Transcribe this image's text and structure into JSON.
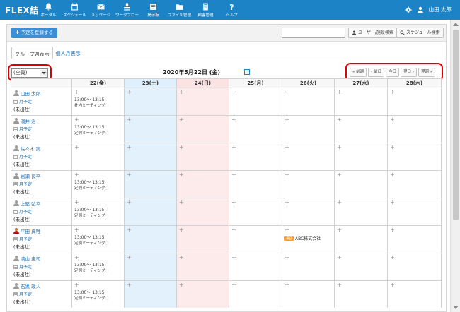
{
  "app": {
    "logo": "FLEX結"
  },
  "nav": [
    {
      "label": "ポータル",
      "icon": "bell-icon"
    },
    {
      "label": "スケジュール",
      "icon": "calendar-icon"
    },
    {
      "label": "メッセージ",
      "icon": "mail-icon"
    },
    {
      "label": "ワークフロー",
      "icon": "stamp-icon"
    },
    {
      "label": "掲示板",
      "icon": "board-icon"
    },
    {
      "label": "ファイル管理",
      "icon": "folder-icon"
    },
    {
      "label": "顧客管理",
      "icon": "customer-icon"
    },
    {
      "label": "ヘルプ",
      "icon": "help-icon"
    }
  ],
  "user": {
    "name": "山田 太郎"
  },
  "toolbar": {
    "register_label": "✚ 予定を登録する",
    "search_value": "",
    "user_search_label": "ユーザー/施設検索",
    "schedule_search_label": "スケジュール検索"
  },
  "tabs": [
    {
      "label": "グループ週表示",
      "active": true
    },
    {
      "label": "個人月表示",
      "active": false
    }
  ],
  "group_select": {
    "selected": "(全員)"
  },
  "date_title": "2020年5月22日 (金)",
  "date_nav": {
    "prev_week": "« 前週",
    "prev_day": "‹ 前日",
    "today": "今日",
    "next_day": "翌日 ›",
    "next_week": "翌週 »"
  },
  "columns": [
    {
      "label": "",
      "kind": "name"
    },
    {
      "label": "22(金)",
      "kind": "today"
    },
    {
      "label": "23(土)",
      "kind": "sat"
    },
    {
      "label": "24(日)",
      "kind": "sun"
    },
    {
      "label": "25(月)",
      "kind": "normal"
    },
    {
      "label": "26(火)",
      "kind": "normal"
    },
    {
      "label": "27(水)",
      "kind": "normal"
    },
    {
      "label": "28(木)",
      "kind": "normal"
    }
  ],
  "rows": [
    {
      "name": "山田 太郎",
      "photo": false,
      "monthly": "月予定",
      "status": "(未出社)",
      "event": {
        "time": "13:00～ 13:15",
        "title": "社内ミーティング"
      },
      "visitor": null
    },
    {
      "name": "濱井 治",
      "photo": false,
      "monthly": "月予定",
      "status": "(未出社)",
      "event": {
        "time": "13:00～ 13:15",
        "title": "定例ミーティング"
      },
      "visitor": null
    },
    {
      "name": "佐々木 実",
      "photo": false,
      "monthly": "月予定",
      "status": "(未出社)",
      "event": null,
      "visitor": null
    },
    {
      "name": "岩瀬 良平",
      "photo": false,
      "monthly": "月予定",
      "status": "(未出社)",
      "event": {
        "time": "13:00～ 13:15",
        "title": "定例ミーティング"
      },
      "visitor": null
    },
    {
      "name": "上堅 弘幸",
      "photo": false,
      "monthly": "月予定",
      "status": "(未出社)",
      "event": {
        "time": "13:00～ 13:15",
        "title": "定例ミーティング"
      },
      "visitor": null
    },
    {
      "name": "平田 真唯",
      "photo": true,
      "monthly": "月予定",
      "status": "(未出社)",
      "event": {
        "time": "13:00～ 13:15",
        "title": "定例ミーティング"
      },
      "visitor": {
        "badge": "来訪",
        "company": "ABC株式会社"
      }
    },
    {
      "name": "溝山 圭司",
      "photo": false,
      "monthly": "月予定",
      "status": "(未出社)",
      "event": {
        "time": "13:00～ 13:15",
        "title": "定例ミーティング"
      },
      "visitor": null
    },
    {
      "name": "石黒 政人",
      "photo": false,
      "monthly": "月予定",
      "status": "(未出社)",
      "event": {
        "time": "13:00～ 13:15",
        "title": "定例ミーティング"
      },
      "visitor": null
    }
  ],
  "icons": {
    "plus": "+",
    "event_icon": "◌"
  },
  "colors": {
    "header": "#1c84c6",
    "saturday": "#e3f1fd",
    "sunday": "#fdeaea",
    "link": "#1a6fb8",
    "highlight": "#e00000"
  }
}
